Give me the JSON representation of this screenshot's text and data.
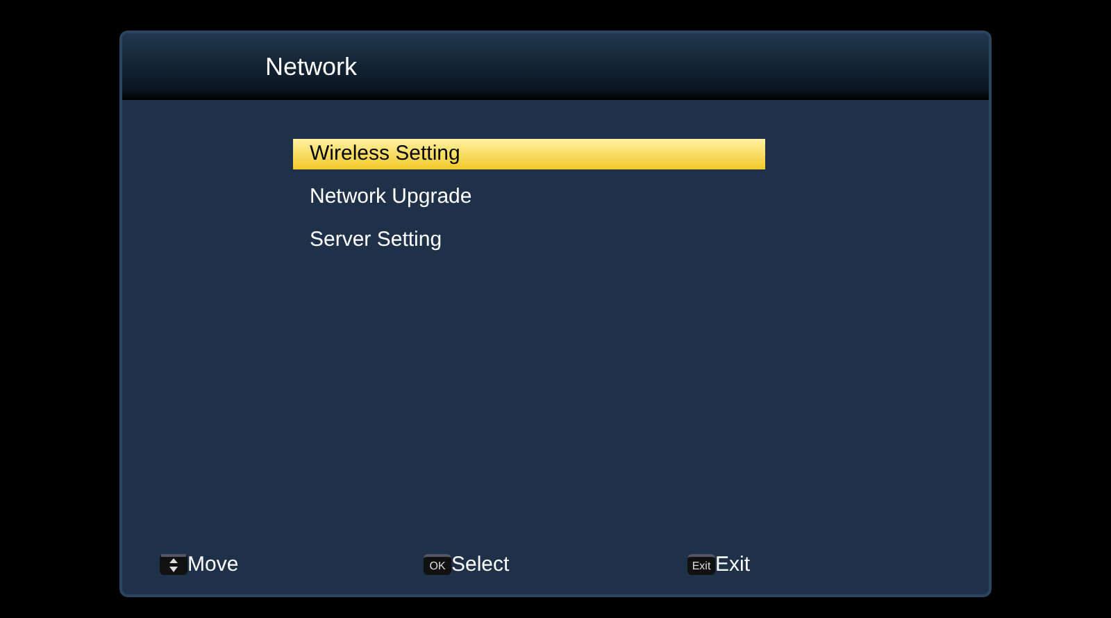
{
  "window": {
    "title": "Network"
  },
  "menu": [
    {
      "label": "Wireless Setting",
      "selected": true
    },
    {
      "label": "Network Upgrade",
      "selected": false
    },
    {
      "label": "Server Setting",
      "selected": false
    }
  ],
  "hints": [
    {
      "kind": "arrows",
      "label": "Move"
    },
    {
      "kind": "key",
      "key": "OK",
      "label": "Select"
    },
    {
      "kind": "key",
      "key": "Exit",
      "label": "Exit"
    }
  ]
}
